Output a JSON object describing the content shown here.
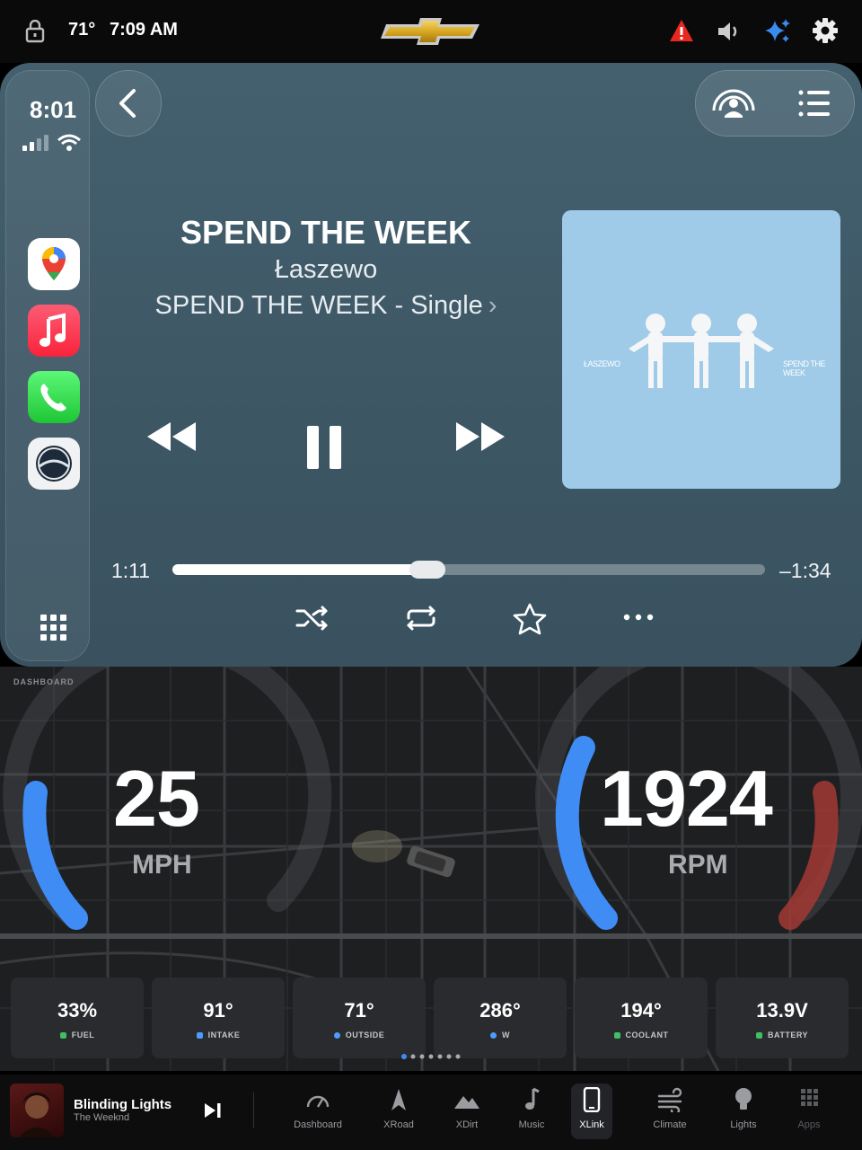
{
  "statusbar": {
    "temperature": "71°",
    "time": "7:09 AM",
    "icons": [
      "lock-icon",
      "chevrolet-logo",
      "warning-icon",
      "volume-icon",
      "sparkle-icon",
      "gear-icon"
    ]
  },
  "carplay": {
    "clock": "8:01",
    "apps": [
      "maps",
      "music",
      "phone",
      "assistant"
    ],
    "now_playing": {
      "title": "SPEND THE WEEK",
      "artist": "Łaszewo",
      "album": "SPEND THE WEEK - Single",
      "album_chevron": "›",
      "art_text_left": "ŁASZEWO",
      "art_text_right": "SPEND THE WEEK",
      "elapsed": "1:11",
      "remaining": "–1:34",
      "progress": 0.43
    }
  },
  "dashboard": {
    "label": "DASHBOARD",
    "speed": "25",
    "speed_unit": "MPH",
    "rpm": "1924",
    "rpm_unit": "RPM",
    "cards": [
      {
        "value": "33%",
        "label": "FUEL",
        "color": "#3fbf5f"
      },
      {
        "value": "91°",
        "label": "INTAKE",
        "color": "#4a9cff"
      },
      {
        "value": "71°",
        "label": "OUTSIDE",
        "color": "#4a9cff"
      },
      {
        "value": "286°",
        "label": "W",
        "color": "#4a9cff"
      },
      {
        "value": "194°",
        "label": "COOLANT",
        "color": "#3fbf5f"
      },
      {
        "value": "13.9V",
        "label": "BATTERY",
        "color": "#3fbf5f"
      }
    ],
    "page_dots": 7,
    "active_dot": 0
  },
  "bottom": {
    "now_playing_title": "Blinding Lights",
    "now_playing_artist": "The Weeknd",
    "nav": [
      {
        "label": "Dashboard",
        "icon": "gauge-icon"
      },
      {
        "label": "XRoad",
        "icon": "road-icon"
      },
      {
        "label": "XDirt",
        "icon": "mountain-icon"
      },
      {
        "label": "Music",
        "icon": "music-note-icon"
      },
      {
        "label": "XLink",
        "icon": "phone-icon"
      },
      {
        "label": "Climate",
        "icon": "wind-icon"
      },
      {
        "label": "Lights",
        "icon": "bulb-icon"
      },
      {
        "label": "Apps",
        "icon": "grid-icon"
      }
    ],
    "active_nav": "XLink"
  },
  "colors": {
    "accent_blue": "#3f8cf5",
    "rpm_red": "#a23a35",
    "carplay_bg": "#3f5766"
  }
}
